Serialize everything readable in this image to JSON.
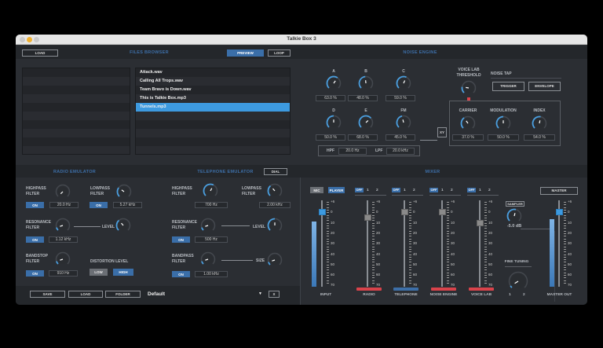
{
  "window": {
    "title": "Talkie Box 3"
  },
  "files": {
    "load": "LOAD",
    "header": "FILES BROWSER",
    "preview": "PREVIEW",
    "loop": "LOOP",
    "items": [
      "Attack.wav",
      "Calling All Trops.wav",
      "Team Bravo is Down.wav",
      "This is Talkie Box.mp3",
      "Tunnels.mp3"
    ],
    "selected_index": 4
  },
  "noise": {
    "header": "NOISE ENGINE",
    "knobs": [
      {
        "label": "A",
        "value": "63.0 %",
        "level": 0.63
      },
      {
        "label": "B",
        "value": "48.0 %",
        "level": 0.48
      },
      {
        "label": "C",
        "value": "59.0 %",
        "level": 0.59
      },
      {
        "label": "D",
        "value": "50.0 %",
        "level": 0.5
      },
      {
        "label": "E",
        "value": "68.0 %",
        "level": 0.68
      },
      {
        "label": "FM",
        "value": "45.0 %",
        "level": 0.45
      }
    ],
    "hpf_label": "HPF",
    "hpf": "20.0 Hz",
    "lpf_label": "LPF",
    "lpf": "20.0 kHz",
    "xy": "XY",
    "voice_lab_threshold": "VOICE LAB THRESHOLD",
    "threshold_level": 0.2,
    "noise_tap": "NOISE TAP",
    "trigger": "TRIGGER",
    "envelope": "ENVELOPE",
    "fm": [
      {
        "label": "CARRIER",
        "value": "37.0 %",
        "level": 0.37
      },
      {
        "label": "MODULATION",
        "value": "50.0 %",
        "level": 0.5
      },
      {
        "label": "INDEX",
        "value": "54.0 %",
        "level": 0.54
      }
    ]
  },
  "radio": {
    "header": "RADIO EMULATOR",
    "on": "ON",
    "highpass": "HIGHPASS FILTER",
    "highpass_value": "20.0 Hz",
    "highpass_level": 0.0,
    "lowpass": "LOWPASS FILTER",
    "lowpass_value": "5.27 kHz",
    "lowpass_level": 0.3,
    "resonance": "RESONANCE FILTER",
    "resonance_value": "1.12 kHz",
    "resonance_level": 0.1,
    "level": "LEVEL",
    "level_level": 0.35,
    "bandstop": "BANDSTOP FILTER",
    "bandstop_value": "910 Hz",
    "bandstop_level": 0.1,
    "distortion": "DISTORTION LEVEL",
    "low": "LOW",
    "high": "HIGH"
  },
  "telephone": {
    "header": "TELEPHONE EMULATOR",
    "dial": "DIAL",
    "on": "ON",
    "highpass": "HIGHPASS FILTER",
    "highpass_value": "700 Hz",
    "highpass_level": 0.6,
    "lowpass": "LOWPASS FILTER",
    "lowpass_value": "2.00 kHz",
    "lowpass_level": 0.35,
    "resonance": "RESONANCE FILTER",
    "resonance_value": "500 Hz",
    "resonance_level": 0.1,
    "level": "LEVEL",
    "level_level": 0.5,
    "bandpass": "BANDPASS FILTER",
    "bandpass_value": "1.00 kHz",
    "bandpass_level": 0.1,
    "size": "SIZE",
    "size_level": 0.1
  },
  "presets": {
    "save": "SAVE",
    "load": "LOAD",
    "folder": "FOLDER",
    "current": "Default",
    "arrow": "▼",
    "extra": "X"
  },
  "mixer": {
    "header": "MIXER",
    "mic": "MIC",
    "player": "PLAYER",
    "scale": [
      "+6",
      "0",
      "10",
      "20",
      "30",
      "40",
      "50",
      "60",
      "70"
    ],
    "input": {
      "label": "INPUT",
      "db": 0,
      "meter": 0.78
    },
    "channels": [
      {
        "label": "RADIO",
        "off": "OFF",
        "one": "1",
        "two": "2",
        "db": -5,
        "color": "#d9434b"
      },
      {
        "label": "TELEPHONE",
        "off": "OFF",
        "one": "1",
        "two": "2",
        "db": 0,
        "color": "#3d6fa8"
      },
      {
        "label": "NOISE ENGINE",
        "off": "OFF",
        "one": "1",
        "two": "2",
        "db": 0,
        "color": "#d9434b"
      },
      {
        "label": "VOICE LAB",
        "off": "OFF",
        "one": "1",
        "two": "2",
        "db": -10,
        "color": "#d9434b"
      }
    ],
    "sampler": "SAMPLER",
    "sampler_value": "-5.0 dB",
    "sampler_level": 0.55,
    "fine_tuning": "FINE TUNING",
    "fine_1": "1",
    "fine_2": "2",
    "fine_level": 0.05,
    "master": "MASTER",
    "master_out": {
      "label": "MASTER OUT",
      "db": 0,
      "meter": 0.8
    }
  }
}
